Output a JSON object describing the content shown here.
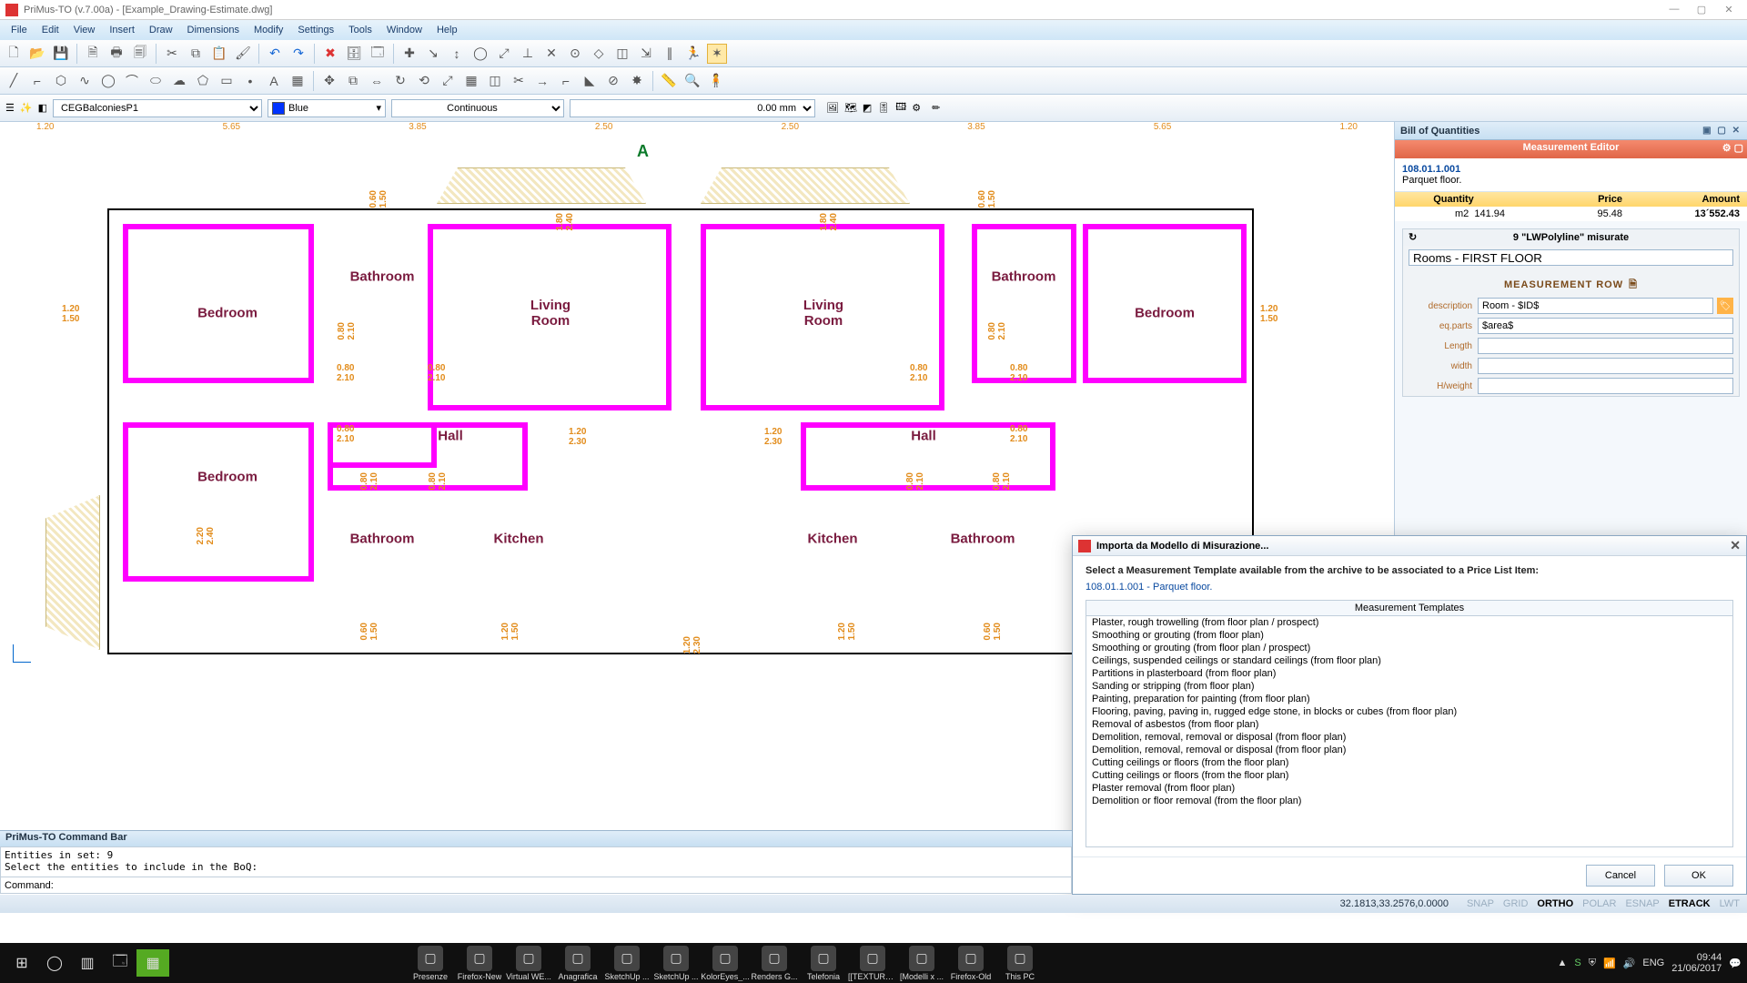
{
  "title": "PriMus-TO (v.7.00a)  -  [Example_Drawing-Estimate.dwg]",
  "menus": [
    "File",
    "Edit",
    "View",
    "Insert",
    "Draw",
    "Dimensions",
    "Modify",
    "Settings",
    "Tools",
    "Window",
    "Help"
  ],
  "layer": "CEGBalconiesP1",
  "color_name": "Blue",
  "linetype": "Continuous",
  "lineweight": "0.00 mm",
  "ruler_h": [
    "1.20",
    "5.65",
    "3.85",
    "2.50",
    "2.50",
    "3.85",
    "5.65",
    "1.20"
  ],
  "section_letter": "A",
  "rooms": {
    "bedroom": "Bedroom",
    "bathroom": "Bathroom",
    "living": "Living\nRoom",
    "kitchen": "Kitchen",
    "hall": "Hall"
  },
  "door_dims": {
    "d080_210": "0.80\n2.10",
    "d120_230": "1.20\n2.30",
    "d060_150": "0.60\n1.50",
    "d120_150": "1.20\n1.50",
    "d180_240": "1.80\n2.40",
    "d220_240": "2.20\n2.40"
  },
  "side": {
    "panel_title": "Bill of Quantities",
    "editor_title": "Measurement Editor",
    "item_code": "108.01.1.001",
    "item_desc": "Parquet floor.",
    "cols": {
      "qty": "Quantity",
      "price": "Price",
      "amt": "Amount"
    },
    "vals": {
      "unit": "m2",
      "qty": "141.94",
      "price": "95.48",
      "amt": "13´552.43"
    },
    "misurate_hdr": "9 \"LWPolyline\" misurate",
    "misurate_val": "Rooms - FIRST FLOOR",
    "mrow_title": "MEASUREMENT ROW",
    "f_desc_lbl": "description",
    "f_desc_val": "Room - $ID$",
    "f_eq_lbl": "eq.parts",
    "f_eq_val": "$area$",
    "f_len_lbl": "Length",
    "f_len_val": "",
    "f_wid_lbl": "width",
    "f_wid_val": "",
    "f_hw_lbl": "H/weight",
    "f_hw_val": ""
  },
  "dialog": {
    "title": "Importa da Modello di Misurazione...",
    "instr": "Select a Measurement Template available from the archive to be associated to a Price List Item:",
    "item": "108.01.1.001 - Parquet floor.",
    "list_hdr": "Measurement Templates",
    "templates": [
      "Plaster, rough trowelling (from floor plan / prospect)",
      "Smoothing or grouting (from floor plan)",
      "Smoothing or grouting (from floor plan / prospect)",
      "Ceilings, suspended ceilings or standard ceilings (from floor plan)",
      "Partitions in plasterboard (from floor plan)",
      "Sanding or stripping (from floor plan)",
      "Painting, preparation for painting (from floor plan)",
      "Flooring, paving, paving in, rugged edge stone, in blocks or cubes (from floor plan)",
      "Removal of asbestos (from floor plan)",
      "Demolition, removal, removal or disposal (from floor plan)",
      "Demolition, removal, removal or disposal (from floor plan)",
      "Cutting ceilings or floors (from the floor plan)",
      "Cutting ceilings or floors (from the floor plan)",
      "Plaster removal (from floor plan)",
      "Demolition or floor removal (from the floor plan)"
    ],
    "cancel": "Cancel",
    "ok": "OK"
  },
  "cmd": {
    "hdr": "PriMus-TO Command Bar",
    "log": "Entities in set: 9\nSelect the entities to include in the BoQ:",
    "prompt": "Command:"
  },
  "status": {
    "coords": "32.1813,33.2576,0.0000",
    "snaps": [
      "SNAP",
      "GRID",
      "ORTHO",
      "POLAR",
      "ESNAP",
      "ETRACK",
      "LWT"
    ],
    "snaps_on": [
      "ORTHO",
      "ETRACK"
    ]
  },
  "taskbar": {
    "apps": [
      "Presenze",
      "Firefox-New",
      "Virtual WE...",
      "Anagrafica",
      "SketchUp ...",
      "SketchUp ...",
      "KolorEyes_...",
      "Renders G...",
      "Telefonia",
      "[[TEXTURE...",
      "[Modelli x ...",
      "Firefox-Old",
      "This PC"
    ],
    "lang": "ENG",
    "time": "09:44",
    "date": "21/06/2017"
  }
}
